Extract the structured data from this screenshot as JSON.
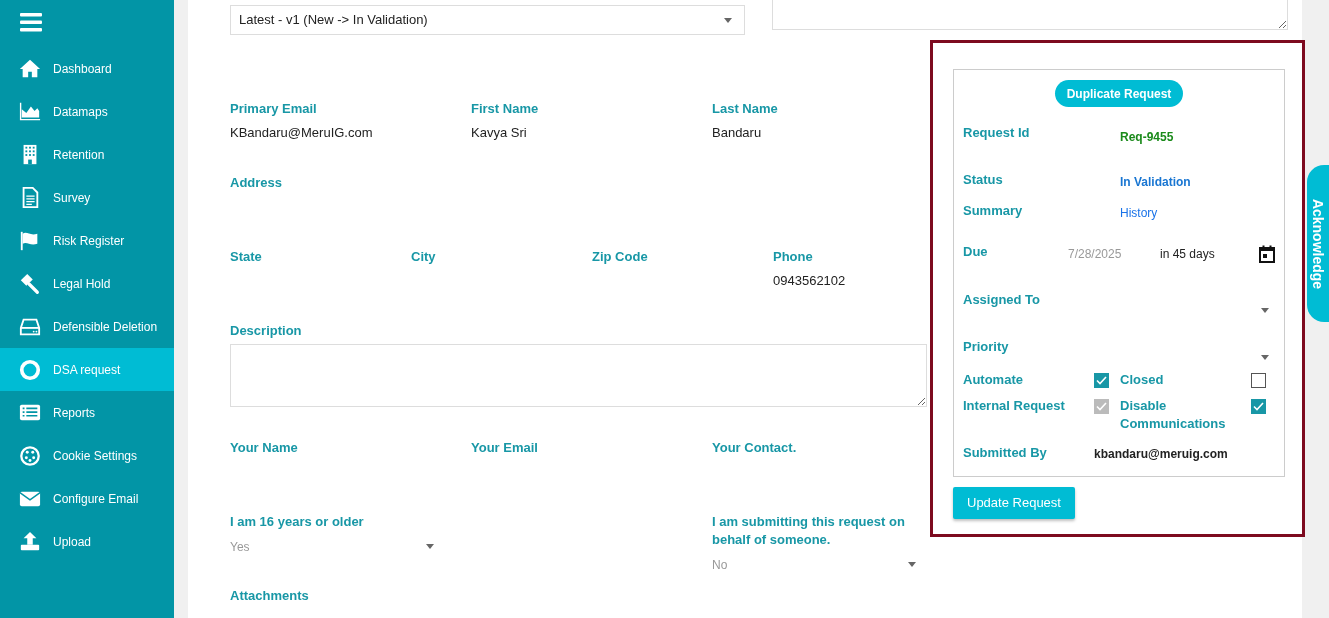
{
  "sidebar": {
    "items": [
      {
        "label": "Dashboard",
        "selected": false
      },
      {
        "label": "Datamaps",
        "selected": false
      },
      {
        "label": "Retention",
        "selected": false
      },
      {
        "label": "Survey",
        "selected": false
      },
      {
        "label": "Risk Register",
        "selected": false
      },
      {
        "label": "Legal Hold",
        "selected": false
      },
      {
        "label": "Defensible Deletion",
        "selected": false
      },
      {
        "label": "DSA request",
        "selected": true
      },
      {
        "label": "Reports",
        "selected": false
      },
      {
        "label": "Cookie Settings",
        "selected": false
      },
      {
        "label": "Configure Email",
        "selected": false
      },
      {
        "label": "Upload",
        "selected": false
      }
    ]
  },
  "version_select": {
    "value": "Latest - v1 (New -> In Validation)"
  },
  "form": {
    "rows": [
      {
        "fields": [
          {
            "kind": "text",
            "label": "Primary Email",
            "value": "KBandaru@MeruIG.com"
          },
          {
            "kind": "text",
            "label": "First Name",
            "value": "Kavya Sri"
          },
          {
            "kind": "text",
            "label": "Last Name",
            "value": "Bandaru"
          }
        ]
      },
      {
        "fields": [
          {
            "kind": "text",
            "label": "Address"
          }
        ]
      },
      {
        "fields": [
          {
            "kind": "text",
            "label": "State"
          },
          {
            "kind": "text",
            "label": "City"
          },
          {
            "kind": "text",
            "label": "Zip Code"
          },
          {
            "kind": "text",
            "label": "Phone",
            "value": "0943562102"
          }
        ]
      },
      {
        "fields": [
          {
            "kind": "textarea",
            "label": "Description"
          }
        ]
      },
      {
        "fields": [
          {
            "kind": "text",
            "label": "Your Name"
          },
          {
            "kind": "text",
            "label": "Your Email"
          },
          {
            "kind": "text",
            "label": "Your Contact."
          }
        ]
      },
      {
        "fields": [
          {
            "kind": "select",
            "label": "I am 16 years or older",
            "placeholder": "Yes"
          },
          {
            "kind": "select",
            "label": "I am submitting this request on behalf of someone.",
            "placeholder": "No"
          }
        ]
      },
      {
        "fields": [
          {
            "kind": "text",
            "label": "Attachments"
          }
        ]
      }
    ]
  },
  "request_panel": {
    "duplicate_button": "Duplicate Request",
    "request_id": {
      "label": "Request Id",
      "value": "Req-9455"
    },
    "status": {
      "label": "Status",
      "value": "In Validation"
    },
    "summary": {
      "label": "Summary",
      "link": "History"
    },
    "due": {
      "label": "Due",
      "date": "7/28/2025",
      "relative": "in 45 days"
    },
    "assigned_to": {
      "label": "Assigned To"
    },
    "priority": {
      "label": "Priority"
    },
    "checkboxes": [
      {
        "label": "Automate",
        "checked": true,
        "disabled": false
      },
      {
        "label": "Closed",
        "checked": false,
        "disabled": false
      },
      {
        "label": "Internal Request",
        "checked": true,
        "disabled": true
      },
      {
        "label": "Disable Communications",
        "checked": true,
        "disabled": false
      }
    ],
    "submitted_by": {
      "label": "Submitted By",
      "value": "kbandaru@meruig.com"
    },
    "update_button": "Update Request"
  },
  "acknowledge_tab": {
    "label": "Acknowledge"
  }
}
